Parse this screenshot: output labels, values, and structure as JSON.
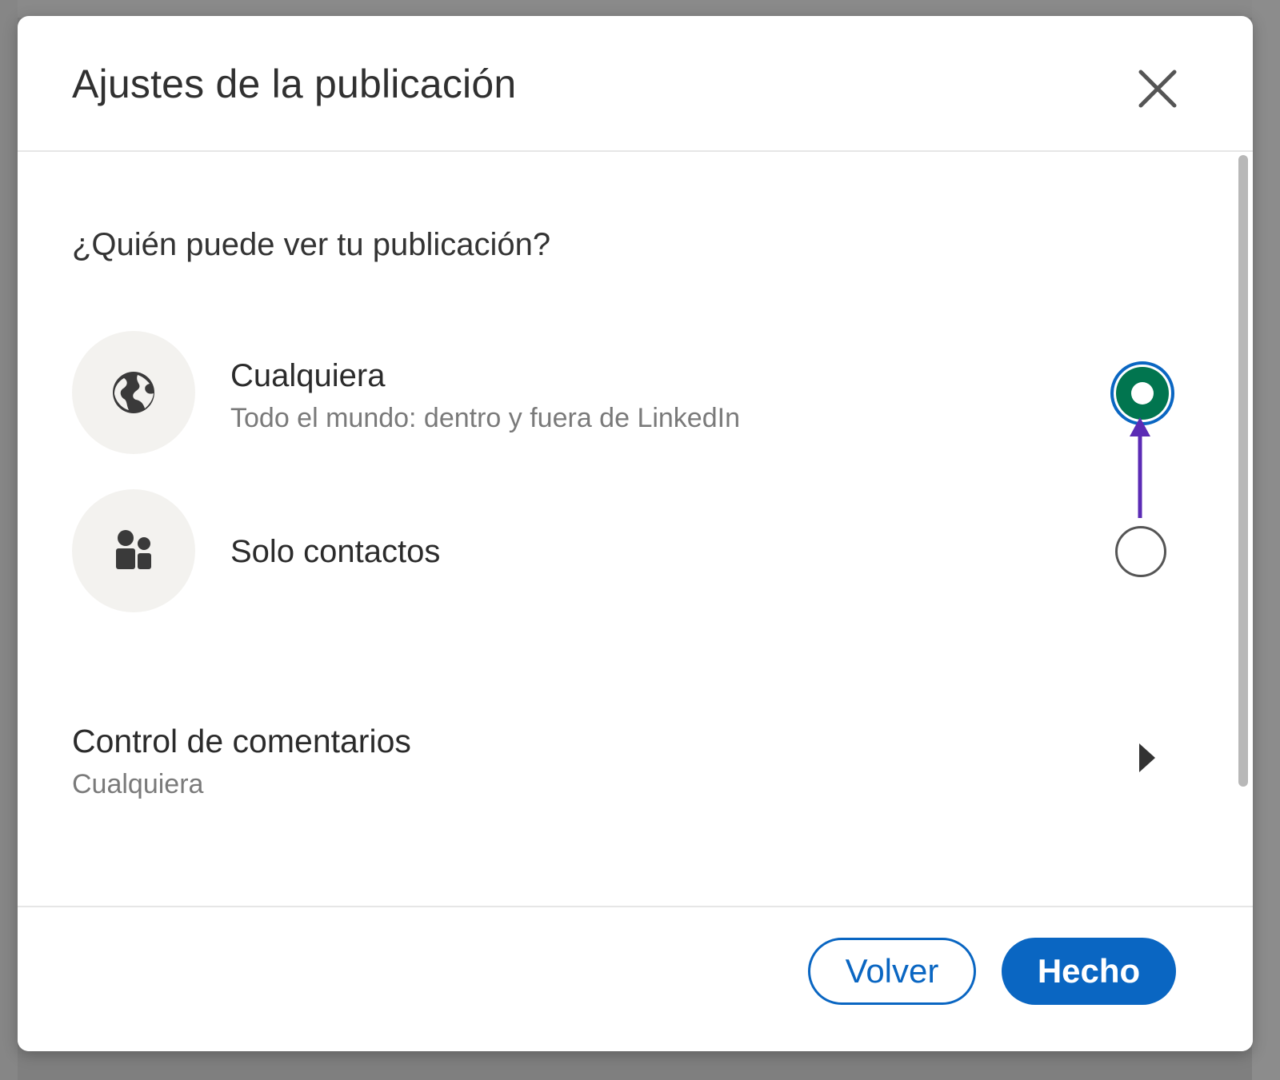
{
  "modal": {
    "title": "Ajustes de la publicación",
    "close_icon": "close-icon"
  },
  "visibility": {
    "heading": "¿Quién puede ver tu publicación?",
    "options": [
      {
        "title": "Cualquiera",
        "subtitle": "Todo el mundo: dentro y fuera de LinkedIn",
        "icon": "globe-icon",
        "selected": true
      },
      {
        "title": "Solo contactos",
        "icon": "contacts-icon",
        "selected": false
      }
    ]
  },
  "comments_control": {
    "title": "Control de comentarios",
    "value": "Cualquiera",
    "icon": "caret-right-icon"
  },
  "footer": {
    "back_label": "Volver",
    "done_label": "Hecho"
  },
  "colors": {
    "primary_blue": "#0a66c2",
    "selected_green": "#01754f",
    "annotation_purple": "#5b2bb5"
  }
}
